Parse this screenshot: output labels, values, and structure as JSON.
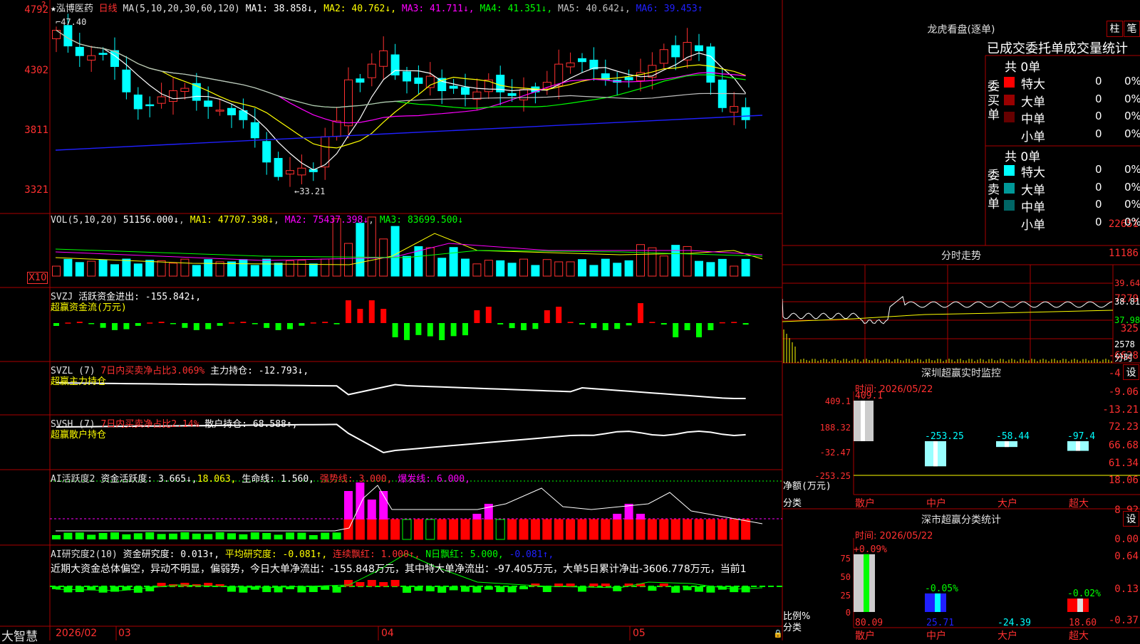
{
  "stock": {
    "name": "泓博医药",
    "period": "日线",
    "ma_title": "MA(5,10,20,30,60,120)",
    "ma": [
      {
        "label": "MA1: 38.858↓",
        "color": "#ffffff"
      },
      {
        "label": "MA2: 40.762↓",
        "color": "#ffff00"
      },
      {
        "label": "MA3: 41.711↓",
        "color": "#ff00ff"
      },
      {
        "label": "MA4: 41.351↓",
        "color": "#00ff00"
      },
      {
        "label": "MA5: 40.642↓",
        "color": "#c0c0c0"
      },
      {
        "label": "MA6: 39.453↑",
        "color": "#2020ff"
      }
    ],
    "high_marker": "47.40",
    "low_marker": "←33.21"
  },
  "price_axis": [
    "4792",
    "4302",
    "3811",
    "3321"
  ],
  "vol": {
    "title": "VOL(5,10,20)",
    "value": "51156.000↓",
    "ma1": "MA1: 47707.398↓",
    "ma2": "MA2: 75437.398↓",
    "ma3": "MA3: 83699.500↓",
    "axis": [
      "22651",
      "11186"
    ],
    "unit": "X10"
  },
  "svzj": {
    "title": "SVZJ",
    "text": "活跃资金进出: -155.842↓,",
    "sub": "超赢资金流(万元)",
    "axis": [
      "7279",
      "325",
      "-6628"
    ]
  },
  "svzl": {
    "title": "SVZL (7)",
    "text1": "7日内买卖净占比3.069%",
    "text2": "主力持仓: -12.793↓,",
    "sub": "超赢主力持仓",
    "axis": [
      "-4.92",
      "-9.06",
      "-13.21"
    ]
  },
  "svsh": {
    "title": "SVSH (7)",
    "text1": "7日内买卖净占比2.14%",
    "text2": "散户持仓: 68.588↑,",
    "sub": "超赢散户持仓",
    "axis": [
      "72.23",
      "66.68",
      "61.34"
    ]
  },
  "ai1": {
    "title": "AI活跃度2",
    "text1": "资金活跃度: 3.665↓,",
    "text2": "18.063,",
    "text3": "生命线: 1.560,",
    "text4": "强势线: 3.000,",
    "text5": "爆发线: 6.000,",
    "axis": [
      "18.06",
      "8.92",
      "0.00"
    ]
  },
  "ai2": {
    "title": "AI研究度2(10)",
    "text1": "资金研究度: 0.013↑,",
    "text2": "平均研究度: -0.081↑,",
    "text3": "连续飘红: 1.000↑,",
    "text4": "N日飘红: 5.000,",
    "text5": "-0.081↑,",
    "summary": "近期大资金总体偏空，异动不明显，偏弱势，今日大单净流出：-155.848万元，其中特大单净流出：-97.405万元，大单5日累计净出-3606.778万元，当前1",
    "axis": [
      "0.64",
      "0.13",
      "-0.37"
    ]
  },
  "date_axis": {
    "brand": "大智慧",
    "labels": [
      "2026/02",
      "03",
      "04",
      "05"
    ]
  },
  "longhu": {
    "title": "龙虎看盘(逐单)",
    "btn1": "柱",
    "btn2": "笔",
    "subtitle": "已成交委托单成交量统计",
    "buy": {
      "total": "共 0单",
      "side": "委买单",
      "rows": [
        {
          "name": "特大",
          "v": "0",
          "p": "0%",
          "color": "#ff0000"
        },
        {
          "name": "大单",
          "v": "0",
          "p": "0%",
          "color": "#990000"
        },
        {
          "name": "中单",
          "v": "0",
          "p": "0%",
          "color": "#660000"
        },
        {
          "name": "小单",
          "v": "0",
          "p": "0%",
          "color": ""
        }
      ]
    },
    "sell": {
      "total": "共 0单",
      "side": "委卖单",
      "rows": [
        {
          "name": "特大",
          "v": "0",
          "p": "0%",
          "color": "#00ffff"
        },
        {
          "name": "大单",
          "v": "0",
          "p": "0%",
          "color": "#009999"
        },
        {
          "name": "中单",
          "v": "0",
          "p": "0%",
          "color": "#006666"
        },
        {
          "name": "小单",
          "v": "0",
          "p": "0%",
          "color": ""
        }
      ]
    }
  },
  "intraday": {
    "title": "分时走势",
    "axis": [
      "39.64",
      "38.81",
      "37.98",
      "2578"
    ],
    "foot": "分时"
  },
  "monitor": {
    "title": "深圳超赢实时监控",
    "btn": "设",
    "date": "时间: 2026/05/22",
    "axis": [
      "409.1",
      "188.32",
      "-32.47",
      "-253.25"
    ],
    "ylabel": "净额(万元)",
    "xlabel": "分类",
    "bars": [
      {
        "cat": "散户",
        "value": 409.1,
        "label": "409.1"
      },
      {
        "cat": "中户",
        "value": -253.25,
        "label": "-253.25"
      },
      {
        "cat": "大户",
        "value": -58.44,
        "label": "-58.44"
      },
      {
        "cat": "超大",
        "value": -97.4,
        "label": "-97.4"
      }
    ]
  },
  "classify": {
    "title": "深市超赢分类统计",
    "btn": "设",
    "date": "时间: 2026/05/22",
    "axis": [
      "75",
      "50",
      "25",
      "0"
    ],
    "ylabel": "比例%",
    "xlabel": "分类",
    "bars": [
      {
        "cat": "散户",
        "value": 80.09,
        "label": "80.09",
        "top": "+0.09%"
      },
      {
        "cat": "中户",
        "value": 25.71,
        "label": "25.71",
        "top": "-0.05%"
      },
      {
        "cat": "大户",
        "value": -24.39,
        "label": "-24.39",
        "top": ""
      },
      {
        "cat": "超大",
        "value": 18.6,
        "label": "18.60",
        "top": "-0.02%"
      }
    ]
  },
  "colors": {
    "up": "#ff3030",
    "down": "#00ffff",
    "grid": "#aa0000",
    "green": "#00ff00",
    "magenta": "#ff00ff"
  }
}
